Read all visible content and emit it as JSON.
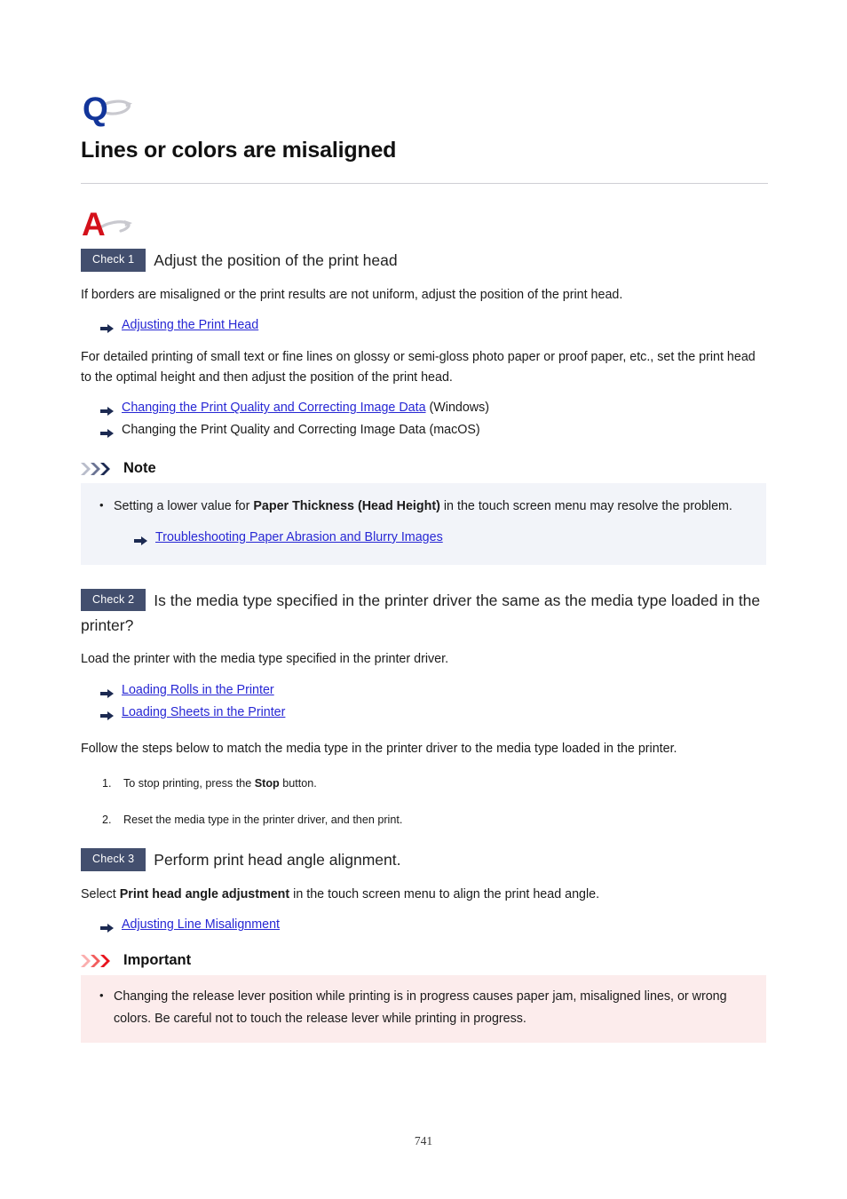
{
  "document": {
    "page_number": "741",
    "question_icon": "question-mark-q-icon",
    "answer_icon": "answer-mark-a-icon",
    "title": "Lines or colors are misaligned"
  },
  "colors": {
    "check_badge_bg": "#434f6e",
    "check_badge_text": "#ffffff",
    "link": "#2727d4",
    "q_icon": "#12359a",
    "a_icon": "#d4101a",
    "note_box_bg": "#f2f4f9",
    "important_box_bg": "#fcecec",
    "note_chevron": "#1c2a52",
    "important_chevron": "#e8131d",
    "rule": "#cfcfd4",
    "arrow_bullet": "#1c2a52"
  },
  "checks": [
    {
      "badge": "Check 1",
      "heading": "Adjust the position of the print head",
      "paragraph_1": "If borders are misaligned or the print results are not uniform, adjust the position of the print head.",
      "link_1": "Adjusting the Print Head",
      "paragraph_2": "For detailed printing of small text or fine lines on glossy or semi-gloss photo paper or proof paper, etc., set the print head to the optimal height and then adjust the position of the print head.",
      "link_2": "Changing the Print Quality and Correcting Image Data",
      "link_2_suffix": "(Windows)",
      "link_3_plain": "Changing the Print Quality and Correcting Image Data (macOS)"
    },
    {
      "badge": "Check 2",
      "heading": "Is the media type specified in the printer driver the same as the media type loaded in the printer?",
      "paragraph_1": "Load the printer with the media type specified in the printer driver.",
      "link_1": "Loading Rolls in the Printer",
      "link_2": "Loading Sheets in the Printer",
      "paragraph_2": "Follow the steps below to match the media type in the printer driver to the media type loaded in the printer.",
      "steps": [
        {
          "prefix": "To stop printing, press the ",
          "bold": "Stop",
          "suffix": " button."
        },
        {
          "prefix": "Reset the media type in the printer driver, and then print.",
          "bold": "",
          "suffix": ""
        }
      ]
    },
    {
      "badge": "Check 3",
      "heading": "Perform print head angle alignment.",
      "paragraph_prefix": "Select ",
      "paragraph_bold": "Print head angle adjustment",
      "paragraph_suffix": " in the touch screen menu to align the print head angle.",
      "link_1": "Adjusting Line Misalignment"
    }
  ],
  "note": {
    "title": "Note",
    "bullet_prefix": "Setting a lower value for ",
    "bullet_bold": "Paper Thickness (Head Height)",
    "bullet_suffix": " in the touch screen menu may resolve the problem.",
    "link": "Troubleshooting Paper Abrasion and Blurry Images"
  },
  "important": {
    "title": "Important",
    "bullet": "Changing the release lever position while printing is in progress causes paper jam, misaligned lines, or wrong colors. Be careful not to touch the release lever while printing in progress."
  }
}
